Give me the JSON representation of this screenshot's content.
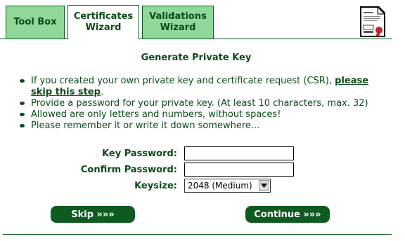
{
  "tabs": [
    {
      "label": "Tool Box",
      "active": false
    },
    {
      "label": "Certificates\nWizard",
      "active": true
    },
    {
      "label": "Validations\nWizard",
      "active": false
    }
  ],
  "page": {
    "title": "Generate Private Key"
  },
  "notes": {
    "item1_text": "If you created your own private key and certificate request (CSR), ",
    "item1_link": "please skip this step",
    "item1_end": ".",
    "item2": "Provide a password for your private key. (At least 10 characters, max. 32)",
    "item3": "Allowed are only letters and numbers, without spaces!",
    "item4": "Please remember it or write it down somewhere..."
  },
  "form": {
    "key_password_label": "Key Password:",
    "key_password_value": "",
    "confirm_password_label": "Confirm Password:",
    "confirm_password_value": "",
    "keysize_label": "Keysize:",
    "keysize_selected": "2048 (Medium)"
  },
  "buttons": {
    "skip": "Skip »»»",
    "continue": "Continue »»»"
  },
  "icons": {
    "document": "certificate-document-icon",
    "bullet": "bullet-icon",
    "dropdown": "chevron-down-icon"
  },
  "colors": {
    "accent": "#0e5a21",
    "tab_inactive": "#8fd89a",
    "text": "#0c4a17"
  }
}
